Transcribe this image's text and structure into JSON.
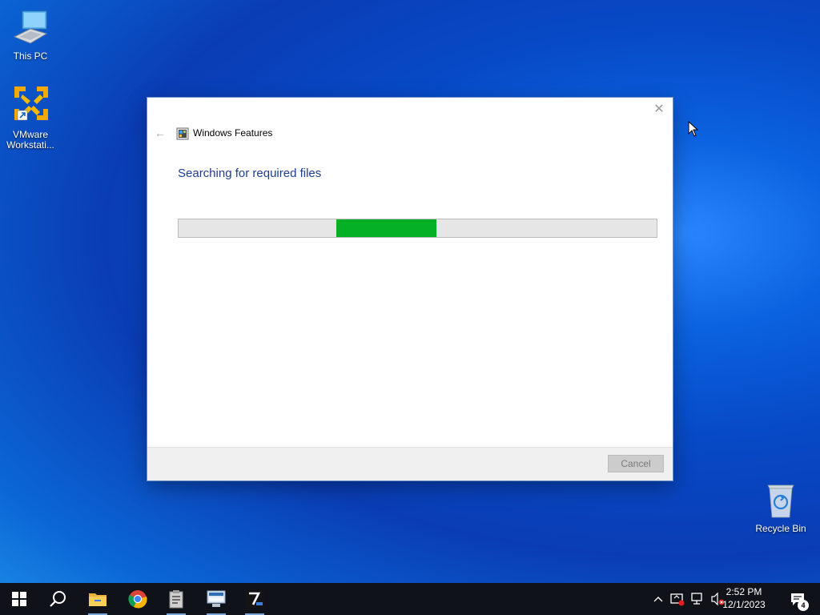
{
  "desktop": {
    "icons": [
      {
        "label": "This PC"
      },
      {
        "label": "VMware Workstati..."
      },
      {
        "label": "Recycle Bin"
      }
    ]
  },
  "dialog": {
    "title": "Windows Features",
    "heading": "Searching for required files",
    "progress": {
      "fill_start": 0.33,
      "fill_end": 0.54,
      "color": "#06b025"
    },
    "cancel_label": "Cancel",
    "close_glyph": "✕",
    "back_glyph": "←"
  },
  "taskbar": {
    "apps": [
      {
        "name": "start"
      },
      {
        "name": "search"
      },
      {
        "name": "file-explorer"
      },
      {
        "name": "chrome"
      },
      {
        "name": "clipboard-app"
      },
      {
        "name": "remote-desktop"
      },
      {
        "name": "7zip"
      }
    ],
    "clock": {
      "time": "2:52 PM",
      "date": "12/1/2023"
    },
    "notification_count": "4"
  }
}
